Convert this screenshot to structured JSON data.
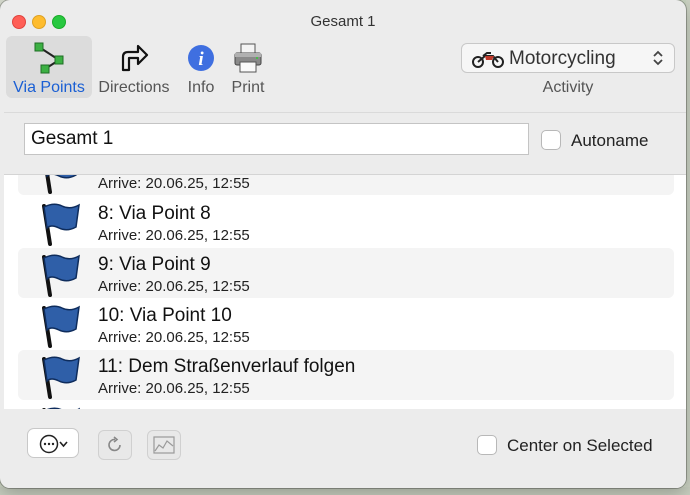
{
  "window": {
    "title": "Gesamt 1"
  },
  "toolbar": {
    "via_points": "Via Points",
    "directions": "Directions",
    "info": "Info",
    "print": "Print",
    "accent_color": "#1a5fd4"
  },
  "activity": {
    "value": "Motorcycling",
    "caption": "Activity",
    "icon": "motorcycle-icon"
  },
  "route_name": {
    "value": "Gesamt 1"
  },
  "autoname": {
    "label": "Autoname",
    "checked": false
  },
  "via_points": [
    {
      "title": "",
      "arrive": "Arrive: 20.06.25, 12:55"
    },
    {
      "title": "8: Via Point 8",
      "arrive": "Arrive: 20.06.25, 12:55"
    },
    {
      "title": "9: Via Point 9",
      "arrive": "Arrive: 20.06.25, 12:55"
    },
    {
      "title": "10: Via Point 10",
      "arrive": "Arrive: 20.06.25, 12:55"
    },
    {
      "title": "11: Dem Straßenverlauf folgen",
      "arrive": "Arrive: 20.06.25, 12:55"
    }
  ],
  "center_on_selected": {
    "label": "Center on Selected",
    "checked": false
  },
  "colors": {
    "flag": "#2f5fa8",
    "selected_tab_bg": "#dcdcdc"
  }
}
